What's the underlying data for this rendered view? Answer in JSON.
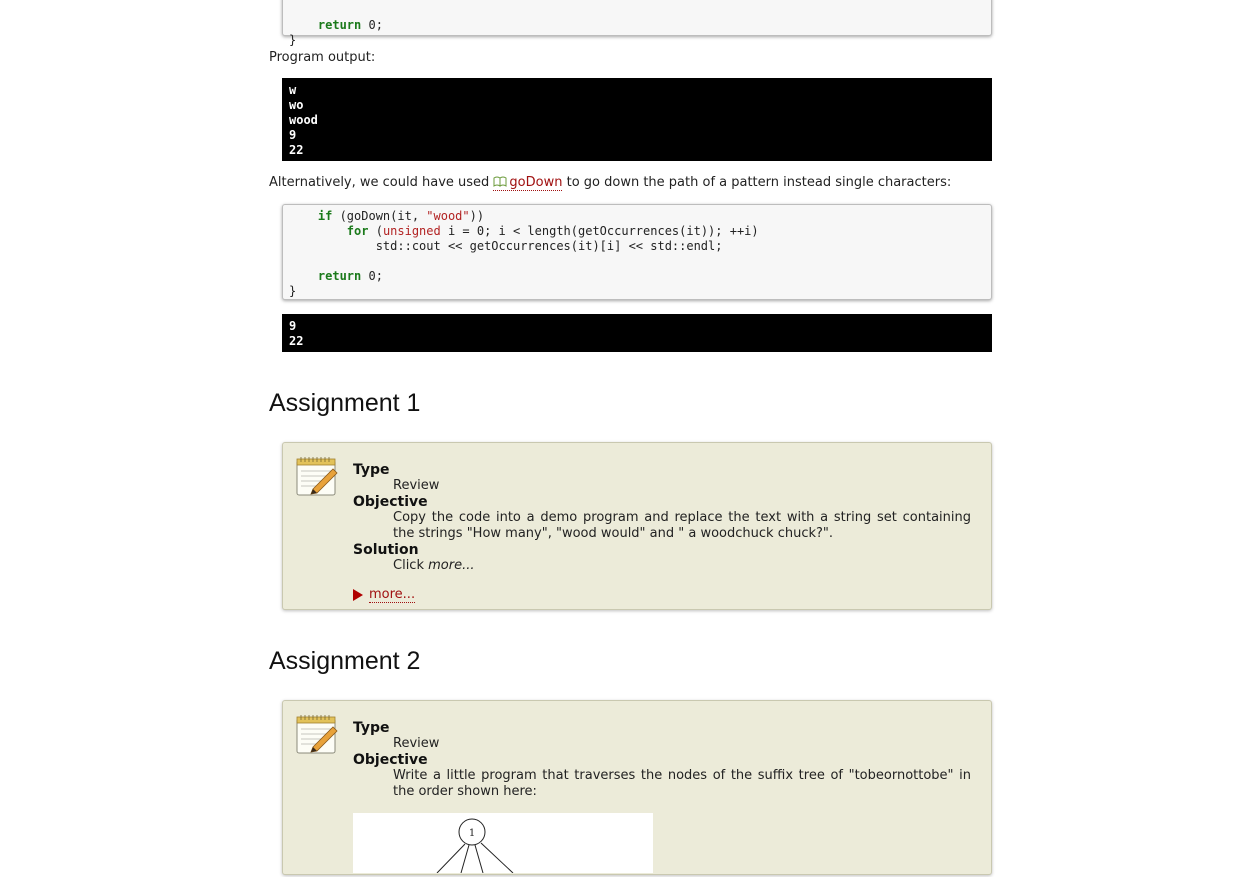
{
  "code_top": {
    "line_return_kw": "return",
    "line_return_rest": " 0;",
    "line_close": "}"
  },
  "program_output_label": "Program output:",
  "output1": {
    "lines": [
      "w",
      "wo",
      "wood",
      "9",
      "22"
    ]
  },
  "alt_text": {
    "before": "Alternatively, we could have used ",
    "link": "goDown",
    "after": " to go down the path of a pattern instead single characters:"
  },
  "code2": {
    "if_kw": "if",
    "if_rest_a": " (goDown(it, ",
    "if_str": "\"wood\"",
    "if_rest_b": "))",
    "for_kw": "for",
    "for_rest_a": " (",
    "for_type": "unsigned",
    "for_rest_b": " i = 0; i < length(getOccurrences(it)); ++i)",
    "cout_line": "std::cout << getOccurrences(it)[i] << std::endl;",
    "return_kw": "return",
    "return_rest": " 0;",
    "close": "}"
  },
  "output2": {
    "lines": [
      "9",
      "22"
    ]
  },
  "assignment1": {
    "heading": "Assignment 1",
    "type_label": "Type",
    "type_value": "Review",
    "objective_label": "Objective",
    "objective_value": "Copy the code into a demo program and replace the text with a string set containing the strings \"How many\", \"wood would\" and \" a woodchuck chuck?\".",
    "solution_label": "Solution",
    "solution_prefix": "Click ",
    "solution_em": "more...",
    "more_link": "more..."
  },
  "assignment2": {
    "heading": "Assignment 2",
    "type_label": "Type",
    "type_value": "Review",
    "objective_label": "Objective",
    "objective_value": "Write a little program that traverses the nodes of the suffix tree of \"tobeornottobe\" in the order shown here:",
    "diagram_root_label": "1"
  },
  "icons": {
    "notepad": "notepad-pencil-icon",
    "book": "book-icon",
    "triangle": "triangle-right-icon"
  },
  "colors": {
    "keyword": "#1b7a1b",
    "string": "#b22222",
    "link": "#a01010",
    "assignment_bg": "#ecebd9",
    "output_bg": "#000000"
  }
}
